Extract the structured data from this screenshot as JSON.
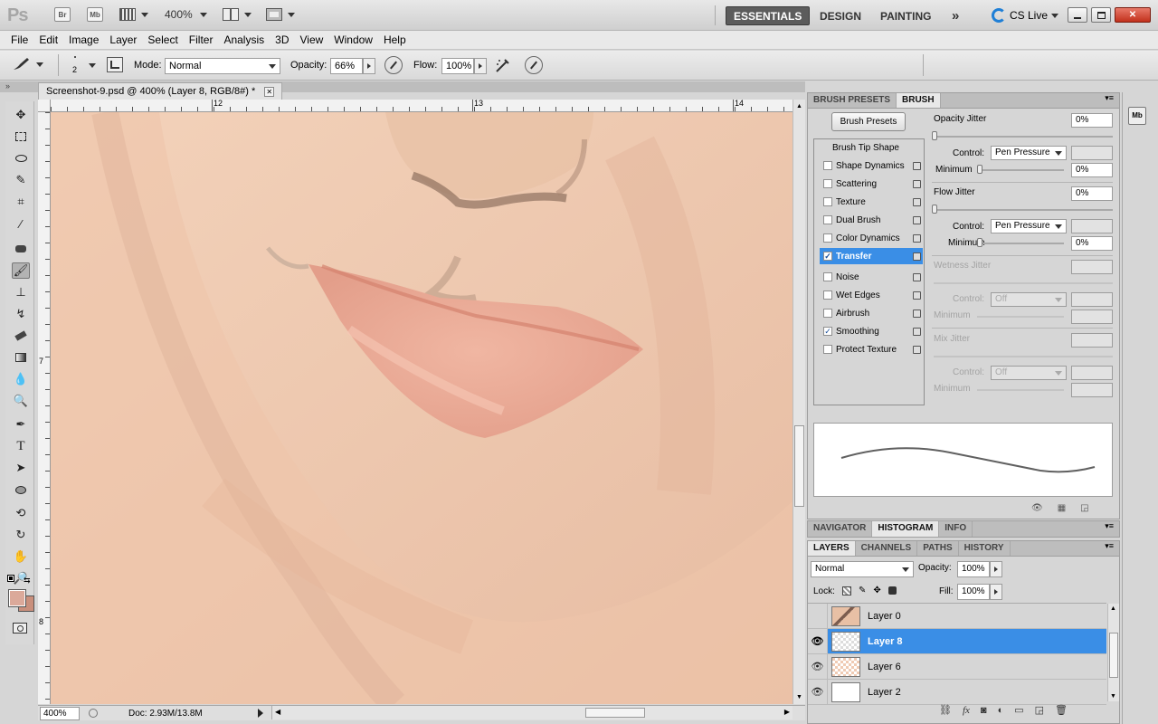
{
  "app": {
    "logo": "Ps",
    "launch_bridge": "Br",
    "launch_minibridge": "Mb",
    "zoom": "400%",
    "workspaces": [
      "ESSENTIALS",
      "DESIGN",
      "PAINTING"
    ],
    "more": "»",
    "cslive": "CS Live"
  },
  "menu": [
    "File",
    "Edit",
    "Image",
    "Layer",
    "Select",
    "Filter",
    "Analysis",
    "3D",
    "View",
    "Window",
    "Help"
  ],
  "options": {
    "brush_size": "2",
    "mode_label": "Mode:",
    "mode_value": "Normal",
    "opacity_label": "Opacity:",
    "opacity_value": "66%",
    "flow_label": "Flow:",
    "flow_value": "100%"
  },
  "document": {
    "tab_title": "Screenshot-9.psd @ 400% (Layer 8, RGB/8#) *",
    "ruler_top": [
      "12",
      "13",
      "14"
    ],
    "ruler_left": [
      "7",
      "8"
    ],
    "zoom_status": "400%",
    "doc_status": "Doc: 2.93M/13.8M"
  },
  "brush_panel": {
    "tabs": [
      "BRUSH PRESETS",
      "BRUSH"
    ],
    "presets_button": "Brush Presets",
    "header_item": "Brush Tip Shape",
    "items": [
      {
        "label": "Shape Dynamics",
        "checked": false
      },
      {
        "label": "Scattering",
        "checked": false
      },
      {
        "label": "Texture",
        "checked": false
      },
      {
        "label": "Dual Brush",
        "checked": false
      },
      {
        "label": "Color Dynamics",
        "checked": false
      },
      {
        "label": "Transfer",
        "checked": true
      },
      {
        "label": "Noise",
        "checked": false
      },
      {
        "label": "Wet Edges",
        "checked": false
      },
      {
        "label": "Airbrush",
        "checked": false
      },
      {
        "label": "Smoothing",
        "checked": true
      },
      {
        "label": "Protect Texture",
        "checked": false
      }
    ],
    "opacity_jitter": "Opacity Jitter",
    "opacity_jitter_value": "0%",
    "control_label": "Control:",
    "control_value": "Pen Pressure",
    "minimum_label": "Minimum",
    "minimum_value": "0%",
    "flow_jitter": "Flow Jitter",
    "flow_jitter_value": "0%",
    "control2_value": "Pen Pressure",
    "minimum2_label": "Minimum",
    "minimum2_value": "0%",
    "wetness_jitter": "Wetness Jitter",
    "control3_value": "Off",
    "mix_jitter": "Mix Jitter",
    "control4_value": "Off"
  },
  "nav_tabs": [
    "NAVIGATOR",
    "HISTOGRAM",
    "INFO"
  ],
  "layers_panel": {
    "tabs": [
      "LAYERS",
      "CHANNELS",
      "PATHS",
      "HISTORY"
    ],
    "blend_mode": "Normal",
    "opacity_label": "Opacity:",
    "opacity_value": "100%",
    "lock_label": "Lock:",
    "fill_label": "Fill:",
    "fill_value": "100%",
    "layers": [
      {
        "name": "Layer 0",
        "visible": false,
        "selected": false
      },
      {
        "name": "Layer 8",
        "visible": true,
        "selected": true
      },
      {
        "name": "Layer 6",
        "visible": true,
        "selected": false
      },
      {
        "name": "Layer 2",
        "visible": true,
        "selected": false
      }
    ]
  },
  "colors": {
    "foreground": "#dba99a",
    "background": "#c98f7c",
    "selection": "#3a8ee6",
    "skin": "#f0c9ae"
  }
}
